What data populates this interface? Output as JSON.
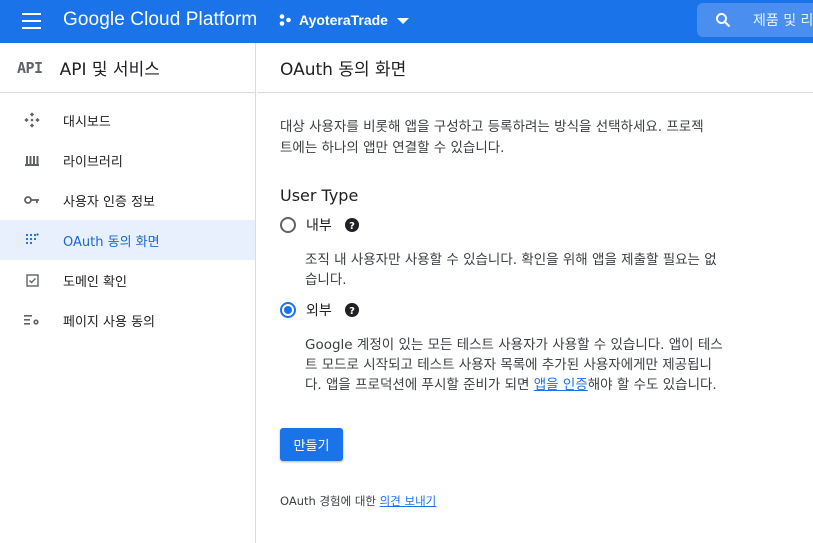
{
  "topbar": {
    "logo_text": "Google Cloud Platform",
    "project_name": "AyoteraTrade",
    "search_placeholder": "제품 및 리"
  },
  "sidebar": {
    "api_logo": "API",
    "title": "API 및 서비스",
    "items": [
      {
        "label": "대시보드",
        "icon": "dashboard-icon",
        "active": false
      },
      {
        "label": "라이브러리",
        "icon": "library-icon",
        "active": false
      },
      {
        "label": "사용자 인증 정보",
        "icon": "key-icon",
        "active": false
      },
      {
        "label": "OAuth 동의 화면",
        "icon": "oauth-consent-icon",
        "active": true
      },
      {
        "label": "도메인 확인",
        "icon": "domain-verification-icon",
        "active": false
      },
      {
        "label": "페이지 사용 동의",
        "icon": "page-usage-agreement-icon",
        "active": false
      }
    ]
  },
  "main": {
    "title": "OAuth 동의 화면",
    "description_line1": "대상 사용자를 비롯해 앱을 구성하고 등록하려는 방식을 선택하세요. 프로젝",
    "description_line2": "트에는 하나의 앱만 연결할 수 있습니다.",
    "user_type_title": "User Type",
    "internal": {
      "label": "내부",
      "checked": false,
      "desc_line1": "조직 내 사용자만 사용할 수 있습니다. 확인을 위해 앱을 제출할 필요는 없",
      "desc_line2": "습니다."
    },
    "external": {
      "label": "외부",
      "checked": true,
      "desc_line1": "Google 계정이 있는 모든 테스트 사용자가 사용할 수 있습니다. 앱이 테스",
      "desc_line2": "트 모드로 시작되고 테스트 사용자 목록에 추가된 사용자에게만 제공됩니",
      "desc_line3_pre": "다. 앱을 프로덕션에 푸시할 준비가 되면 ",
      "desc_line3_link": "앱을 인증",
      "desc_line3_post": "해야 할 수도 있습니다."
    },
    "create_button": "만들기",
    "feedback_prefix": "OAuth 경험에 대한 ",
    "feedback_link": "의견 보내기"
  },
  "colors": {
    "brand_blue": "#1a73e8",
    "active_bg": "#e8f0fe",
    "active_text": "#1967d2"
  }
}
